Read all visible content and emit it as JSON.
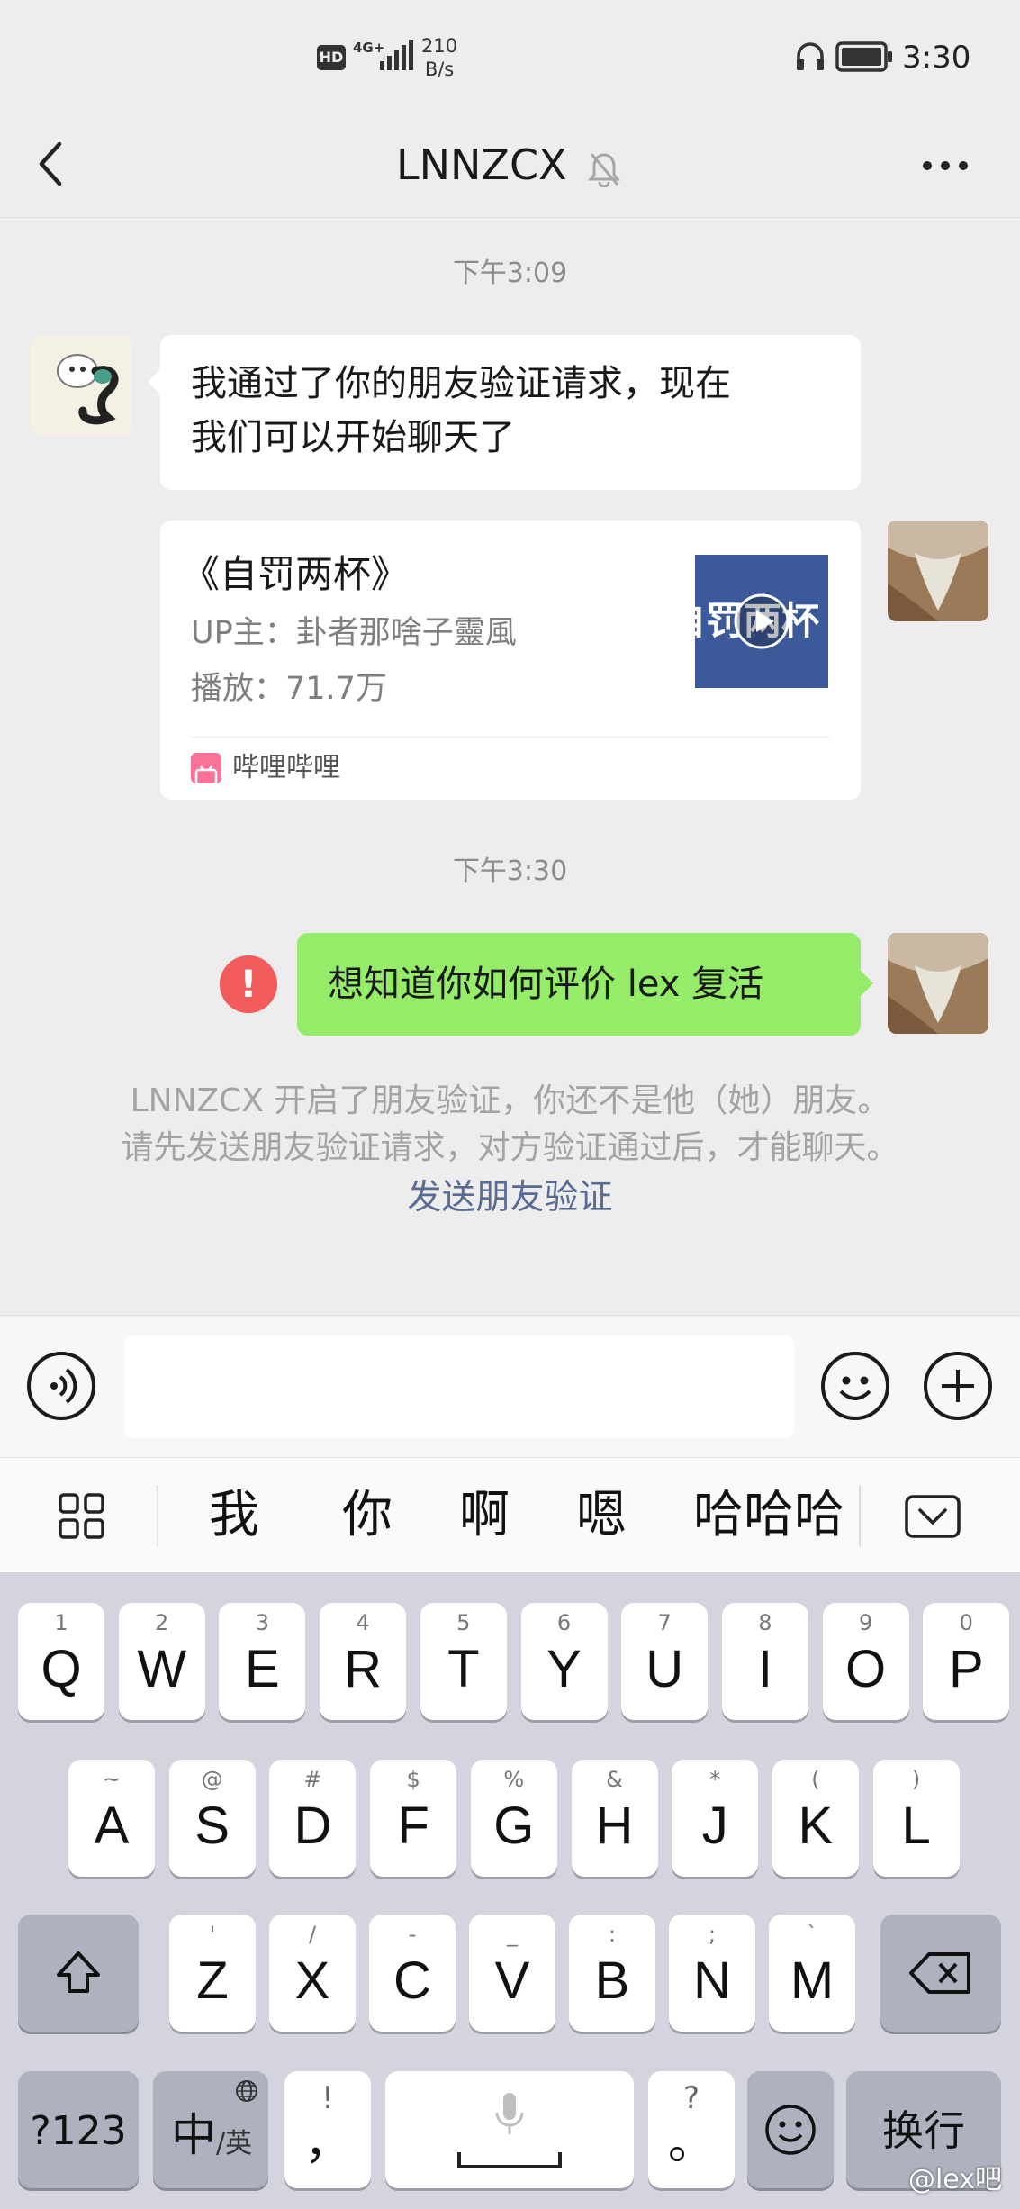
{
  "status_bar": {
    "hd": "HD",
    "network": "4G+",
    "speed_value": "210",
    "speed_unit": "B/s",
    "time": "3:30"
  },
  "nav": {
    "title": "LNNZCX",
    "back_icon": "chevron-left-icon",
    "mute_icon": "bell-muted-icon",
    "more_icon": "more-dots-icon"
  },
  "chat": {
    "timestamps": [
      "下午3:09",
      "下午3:30"
    ],
    "received_message_line1": "我通过了你的朋友验证请求，现在",
    "received_message_line2": "我们可以开始聊天了",
    "shared_card": {
      "title": "《自罚两杯》",
      "uploader_label": "UP主：",
      "uploader": "卦者那啥子靈風",
      "plays_label": "播放：",
      "plays": "71.7万",
      "thumbnail_text": "自罚两杯",
      "source": "哔哩哔哩"
    },
    "sent_message": "想知道你如何评价 lex 复活",
    "failed_indicator": "!",
    "system_note_line1": "LNNZCX 开启了朋友验证，你还不是他（她）朋友。",
    "system_note_line2": "请先发送朋友验证请求，对方验证通过后，才能聊天。",
    "system_link": "发送朋友验证"
  },
  "input_bar": {
    "voice_icon": "voice-icon",
    "input_value": "",
    "emoji_icon": "emoji-icon",
    "plus_icon": "plus-circle-icon"
  },
  "candidates": {
    "grid_icon": "grid-icon",
    "words": [
      "我",
      "你",
      "啊",
      "嗯",
      "哈哈哈"
    ],
    "collapse_icon": "keyboard-collapse-icon"
  },
  "keyboard": {
    "row1": [
      {
        "hint": "1",
        "key": "Q"
      },
      {
        "hint": "2",
        "key": "W"
      },
      {
        "hint": "3",
        "key": "E"
      },
      {
        "hint": "4",
        "key": "R"
      },
      {
        "hint": "5",
        "key": "T"
      },
      {
        "hint": "6",
        "key": "Y"
      },
      {
        "hint": "7",
        "key": "U"
      },
      {
        "hint": "8",
        "key": "I"
      },
      {
        "hint": "9",
        "key": "O"
      },
      {
        "hint": "0",
        "key": "P"
      }
    ],
    "row2": [
      {
        "hint": "~",
        "key": "A"
      },
      {
        "hint": "@",
        "key": "S"
      },
      {
        "hint": "#",
        "key": "D"
      },
      {
        "hint": "$",
        "key": "F"
      },
      {
        "hint": "%",
        "key": "G"
      },
      {
        "hint": "&",
        "key": "H"
      },
      {
        "hint": "*",
        "key": "J"
      },
      {
        "hint": "(",
        "key": "K"
      },
      {
        "hint": ")",
        "key": "L"
      }
    ],
    "row3": [
      {
        "hint": "'",
        "key": "Z"
      },
      {
        "hint": "/",
        "key": "X"
      },
      {
        "hint": "-",
        "key": "C"
      },
      {
        "hint": "_",
        "key": "V"
      },
      {
        "hint": ":",
        "key": "B"
      },
      {
        "hint": ";",
        "key": "N"
      },
      {
        "hint": "`",
        "key": "M"
      }
    ],
    "num_key": "?123",
    "lang_key_main": "中",
    "lang_key_sub": "/英",
    "comma_hint": "!",
    "comma_key": "，",
    "period_hint": "?",
    "period_key": "。",
    "enter_key": "换行",
    "watermark": "@lex吧"
  }
}
